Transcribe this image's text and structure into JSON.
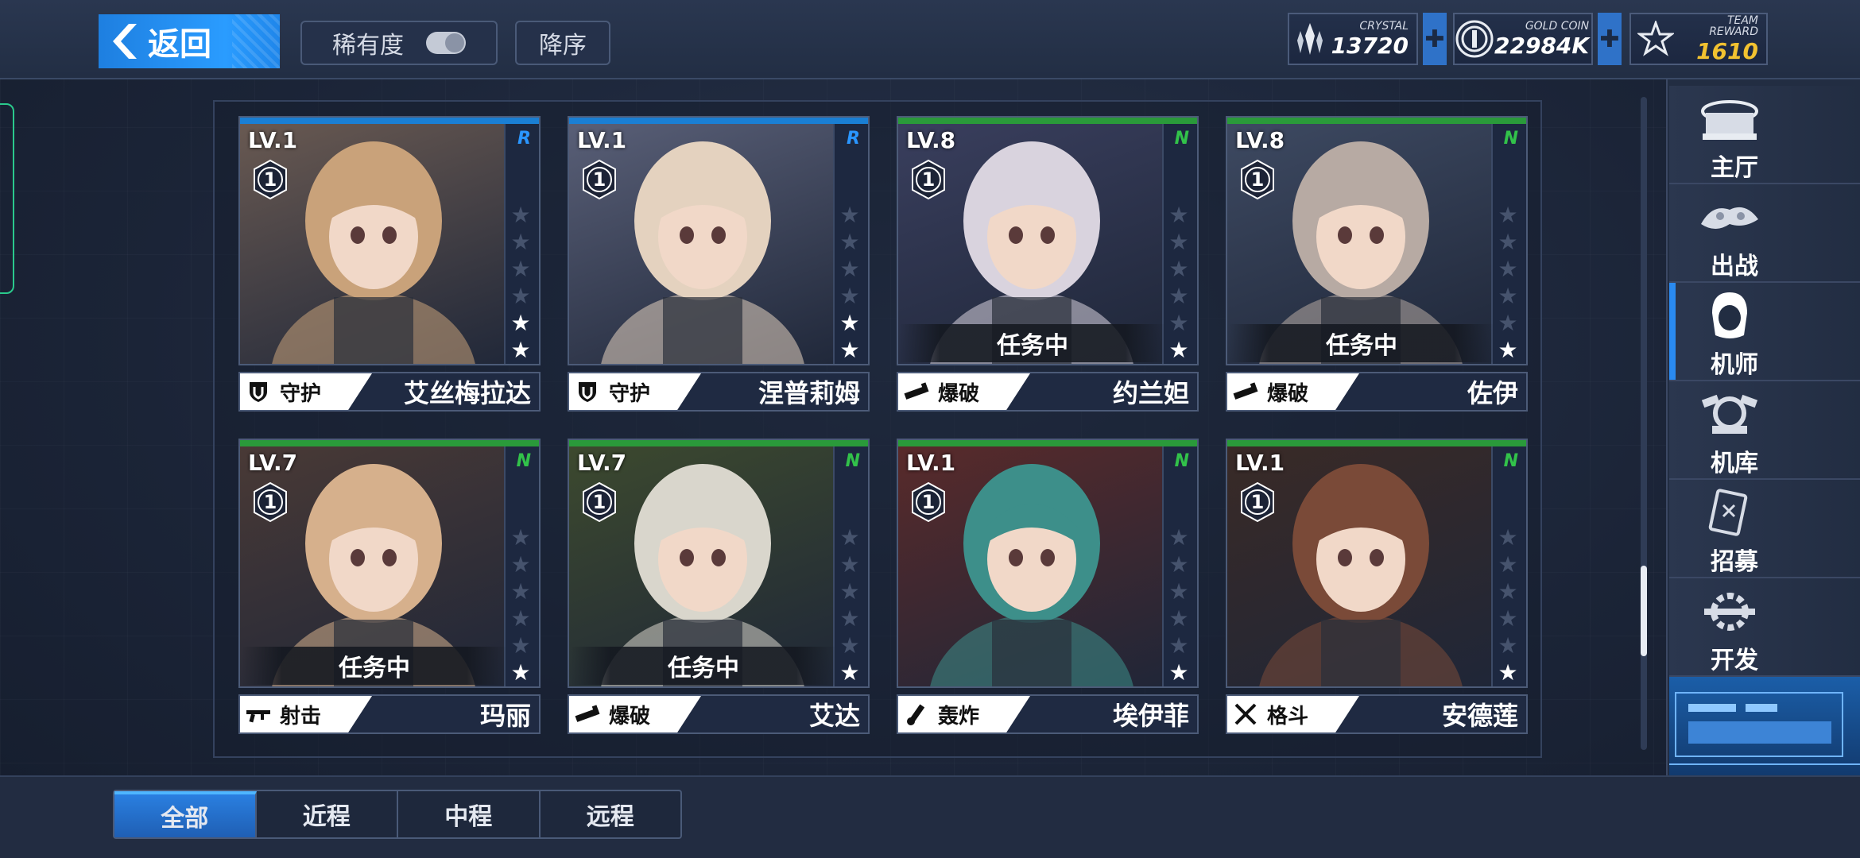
{
  "header": {
    "back_label": "返回",
    "rarity_sort_label": "稀有度",
    "order_label": "降序",
    "currencies": [
      {
        "label": "CRYSTAL",
        "value": "13720",
        "icon": "crystal-icon",
        "color": "#ffffff"
      },
      {
        "label": "GOLD COIN",
        "value": "22984K",
        "icon": "gold-coin-icon",
        "color": "#ffffff"
      },
      {
        "label": "TEAM REWARD",
        "value": "1610",
        "icon": "team-reward-icon",
        "color": "#f2c230"
      }
    ],
    "plus_label": "✚"
  },
  "cards": [
    {
      "level": "LV.1",
      "rank": "1",
      "rarity": "R",
      "stars": 2,
      "mission": "",
      "role": "守护",
      "role_icon": "shield-icon",
      "name": "艾丝梅拉达"
    },
    {
      "level": "LV.1",
      "rank": "1",
      "rarity": "R",
      "stars": 2,
      "mission": "",
      "role": "守护",
      "role_icon": "shield-icon",
      "name": "涅普莉姆"
    },
    {
      "level": "LV.8",
      "rank": "1",
      "rarity": "N",
      "stars": 1,
      "mission": "任务中",
      "role": "爆破",
      "role_icon": "rocket-launcher-icon",
      "name": "约兰妲"
    },
    {
      "level": "LV.8",
      "rank": "1",
      "rarity": "N",
      "stars": 1,
      "mission": "任务中",
      "role": "爆破",
      "role_icon": "rocket-launcher-icon",
      "name": "佐伊"
    },
    {
      "level": "LV.7",
      "rank": "1",
      "rarity": "N",
      "stars": 1,
      "mission": "任务中",
      "role": "射击",
      "role_icon": "rifle-icon",
      "name": "玛丽"
    },
    {
      "level": "LV.7",
      "rank": "1",
      "rarity": "N",
      "stars": 1,
      "mission": "任务中",
      "role": "爆破",
      "role_icon": "rocket-launcher-icon",
      "name": "艾达"
    },
    {
      "level": "LV.1",
      "rank": "1",
      "rarity": "N",
      "stars": 1,
      "mission": "",
      "role": "轰炸",
      "role_icon": "mortar-icon",
      "name": "埃伊菲"
    },
    {
      "level": "LV.1",
      "rank": "1",
      "rarity": "N",
      "stars": 1,
      "mission": "",
      "role": "格斗",
      "role_icon": "crossed-swords-icon",
      "name": "安德莲"
    }
  ],
  "sidebar": {
    "items": [
      {
        "label": "主厅",
        "icon": "hall-icon",
        "active": false
      },
      {
        "label": "出战",
        "icon": "sortie-icon",
        "active": false
      },
      {
        "label": "机师",
        "icon": "pilot-icon",
        "active": true
      },
      {
        "label": "机库",
        "icon": "hangar-icon",
        "active": false
      },
      {
        "label": "招募",
        "icon": "recruit-card-icon",
        "active": false
      },
      {
        "label": "开发",
        "icon": "develop-gear-icon",
        "active": false
      }
    ]
  },
  "filter_tabs": [
    {
      "label": "全部",
      "active": true
    },
    {
      "label": "近程",
      "active": false
    },
    {
      "label": "中程",
      "active": false
    },
    {
      "label": "远程",
      "active": false
    }
  ],
  "scroll": {
    "position": 0.72
  }
}
